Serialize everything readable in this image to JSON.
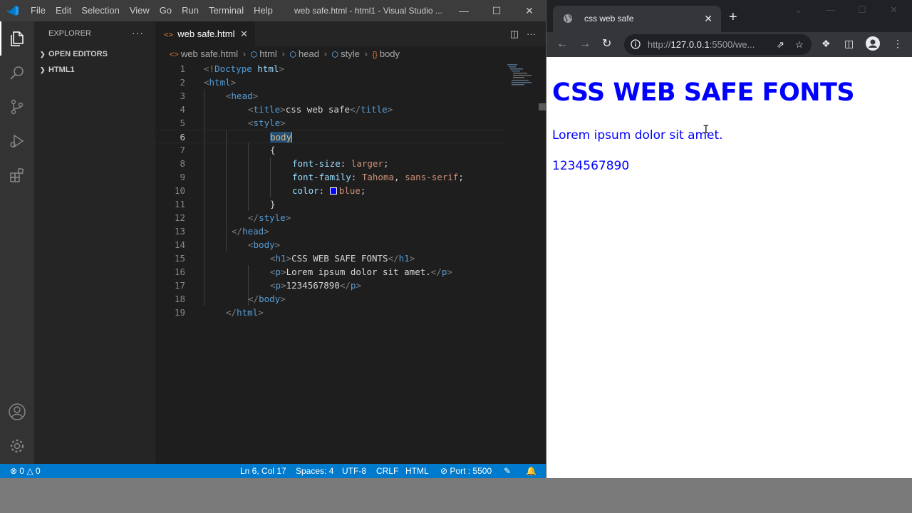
{
  "vscode": {
    "menu": [
      "File",
      "Edit",
      "Selection",
      "View",
      "Go",
      "Run",
      "Terminal",
      "Help"
    ],
    "window_title": "web safe.html - html1 - Visual Studio ...",
    "explorer": {
      "title": "EXPLORER",
      "more": "···",
      "sections": [
        "OPEN EDITORS",
        "HTML1"
      ]
    },
    "tab": {
      "label": "web safe.html",
      "icon": "<>"
    },
    "breadcrumb": [
      "web safe.html",
      "html",
      "head",
      "style",
      "body"
    ],
    "line_numbers": [
      "1",
      "2",
      "3",
      "4",
      "5",
      "6",
      "7",
      "8",
      "9",
      "10",
      "11",
      "12",
      "13",
      "14",
      "15",
      "16",
      "17",
      "18",
      "19"
    ],
    "current_line": "6",
    "status": {
      "errors": "0",
      "warnings": "0",
      "position": "Ln 6, Col 17",
      "spaces": "Spaces: 4",
      "encoding": "UTF-8",
      "eol": "CRLF",
      "language": "HTML",
      "port": "Port : 5500"
    }
  },
  "code": {
    "l1": [
      "<!",
      "Doctype",
      " ",
      "html",
      ">"
    ],
    "l2": [
      "<",
      "html",
      ">"
    ],
    "l3": [
      "<",
      "head",
      ">"
    ],
    "l4": [
      "<",
      "title",
      ">",
      "css web safe",
      "</",
      "title",
      ">"
    ],
    "l5": [
      "<",
      "style",
      ">"
    ],
    "l6": "body",
    "l7": "{",
    "l8": [
      "font-size",
      ": ",
      "larger",
      ";"
    ],
    "l9": [
      "font-family",
      ": ",
      "Tahoma",
      ", ",
      "sans-serif",
      ";"
    ],
    "l10": [
      "color",
      ": ",
      "blue",
      ";"
    ],
    "l11": "}",
    "l12": [
      "</",
      "style",
      ">"
    ],
    "l13": [
      "</",
      "head",
      ">"
    ],
    "l14": [
      "<",
      "body",
      ">"
    ],
    "l15": [
      "<",
      "h1",
      ">",
      "CSS WEB SAFE FONTS",
      "</",
      "h1",
      ">"
    ],
    "l16": [
      "<",
      "p",
      ">",
      "Lorem ipsum dolor sit amet.",
      "</",
      "p",
      ">"
    ],
    "l17": [
      "<",
      "p",
      ">",
      "1234567890",
      "</",
      "p",
      ">"
    ],
    "l18": [
      "</",
      "body",
      ">"
    ],
    "l19": [
      "</",
      "html",
      ">"
    ]
  },
  "colors": {
    "swatch": "#0000ff",
    "accent": "#007acc",
    "page_text": "#0000ff"
  },
  "chrome": {
    "tab_title": "css web safe",
    "url_prefix": "http://",
    "url_host": "127.0.0.1",
    "url_rest": ":5500/we..."
  },
  "page": {
    "h1": "CSS WEB SAFE FONTS",
    "p1": "Lorem ipsum dolor sit amet.",
    "p2": "1234567890"
  }
}
